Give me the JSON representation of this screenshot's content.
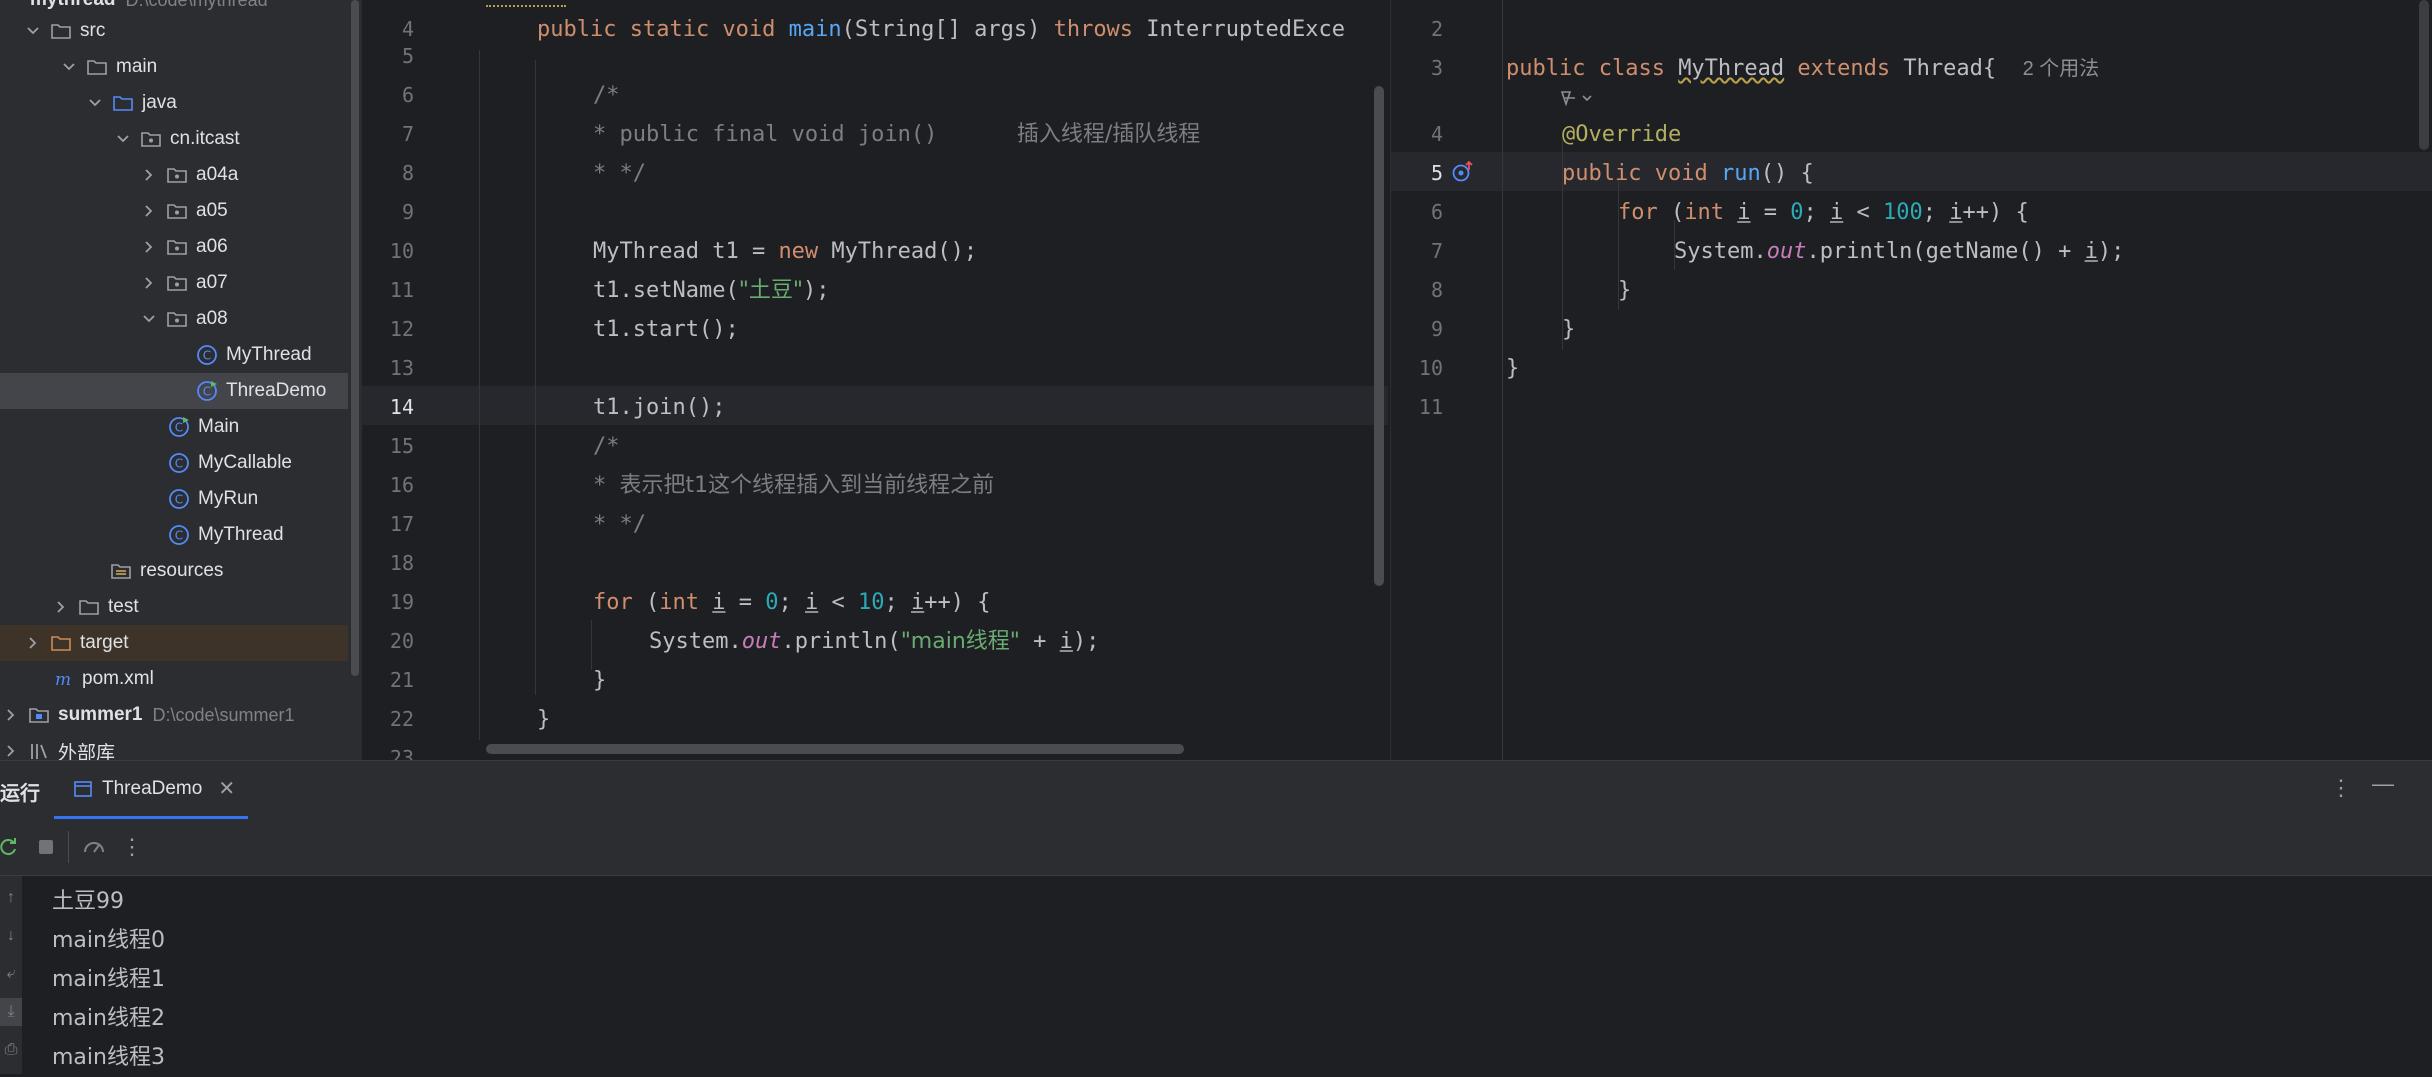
{
  "tree": {
    "project_name": "mythread",
    "project_path": "D:\\code\\mythread",
    "items": [
      {
        "label": "src",
        "type": "folder"
      },
      {
        "label": "main",
        "type": "folder"
      },
      {
        "label": "java",
        "type": "source-root"
      },
      {
        "label": "cn.itcast",
        "type": "package"
      },
      {
        "label": "a04a",
        "type": "package"
      },
      {
        "label": "a05",
        "type": "package"
      },
      {
        "label": "a06",
        "type": "package"
      },
      {
        "label": "a07",
        "type": "package"
      },
      {
        "label": "a08",
        "type": "package"
      },
      {
        "label": "MyThread",
        "type": "class"
      },
      {
        "label": "ThreaDemo",
        "type": "runnable-class"
      },
      {
        "label": "Main",
        "type": "runnable-class"
      },
      {
        "label": "MyCallable",
        "type": "class"
      },
      {
        "label": "MyRun",
        "type": "class"
      },
      {
        "label": "MyThread",
        "type": "class"
      },
      {
        "label": "resources",
        "type": "resources"
      },
      {
        "label": "test",
        "type": "folder"
      },
      {
        "label": "target",
        "type": "excluded-folder"
      },
      {
        "label": "pom.xml",
        "type": "maven"
      },
      {
        "label": "summer1",
        "path": "D:\\code\\summer1",
        "type": "module"
      },
      {
        "label": "外部库",
        "type": "library"
      }
    ]
  },
  "editor_left": {
    "line_numbers": [
      "4",
      "5",
      "6",
      "7",
      "8",
      "9",
      "10",
      "11",
      "12",
      "13",
      "14",
      "15",
      "16",
      "17",
      "18",
      "19",
      "20",
      "21",
      "22",
      "23"
    ],
    "current_line": "14",
    "code": {
      "l4_pre": "public static void ",
      "l4_fn": "main",
      "l4_mid": "(String[] args) ",
      "l4_kw": "throws",
      "l4_post": " InterruptedExce",
      "l6": "/*",
      "l7": "* public final void join()      ",
      "l7_zh": "插入线程/插队线程",
      "l8": "* */",
      "l10_a": "MyThread t1 = ",
      "l10_kw": "new",
      "l10_b": " MyThread();",
      "l11_a": "t1.setName(",
      "l11_str": "\"土豆\"",
      "l11_b": ");",
      "l12": "t1.start();",
      "l14": "t1.join();",
      "l15": "/*",
      "l16": "* ",
      "l16_zh": "表示把t1这个线程插入到当前线程之前",
      "l17": "* */",
      "l19_kw1": "for",
      "l19_a": " (",
      "l19_kw2": "int",
      "l19_sp": " ",
      "l19_i1": "i",
      "l19_b": " = ",
      "l19_n1": "0",
      "l19_c": "; ",
      "l19_i2": "i",
      "l19_d": " < ",
      "l19_n2": "10",
      "l19_e": "; ",
      "l19_i3": "i",
      "l19_f": "++) {",
      "l20_a": "System.",
      "l20_fld": "out",
      "l20_b": ".println(",
      "l20_str": "\"main线程\"",
      "l20_c": " + ",
      "l20_i": "i",
      "l20_d": ");",
      "l21": "}",
      "l22": "}"
    }
  },
  "editor_right": {
    "line_numbers": [
      "2",
      "3",
      "4",
      "5",
      "6",
      "7",
      "8",
      "9",
      "10",
      "11"
    ],
    "current_line": "5",
    "code": {
      "l3_kw": "public class ",
      "l3_cls": "MyThread",
      "l3_kw2": " extends ",
      "l3_post": "Thread{",
      "l3_hint": "2 个用法",
      "l4": "@Override",
      "l5_kw": "public void ",
      "l5_fn": "run",
      "l5_post": "() {",
      "l6_kw1": "for",
      "l6_a": " (",
      "l6_kw2": "int",
      "l6_sp": " ",
      "l6_i1": "i",
      "l6_b": " = ",
      "l6_n1": "0",
      "l6_c": "; ",
      "l6_i2": "i",
      "l6_d": " < ",
      "l6_n2": "100",
      "l6_e": "; ",
      "l6_i3": "i",
      "l6_f": "++) {",
      "l7_a": "System.",
      "l7_fld": "out",
      "l7_b": ".println(getName() + ",
      "l7_i": "i",
      "l7_c": ");",
      "l8": "}",
      "l9": "}",
      "l10": "}"
    }
  },
  "run_panel": {
    "title": "运行",
    "tab_label": "ThreaDemo",
    "output": [
      "土豆99",
      "main线程0",
      "main线程1",
      "main线程2",
      "main线程3"
    ]
  },
  "colors": {
    "accent": "#3574f0",
    "keyword": "#cf8e6d",
    "string": "#6aab73",
    "number": "#2aacb8",
    "function": "#56a8f5"
  }
}
